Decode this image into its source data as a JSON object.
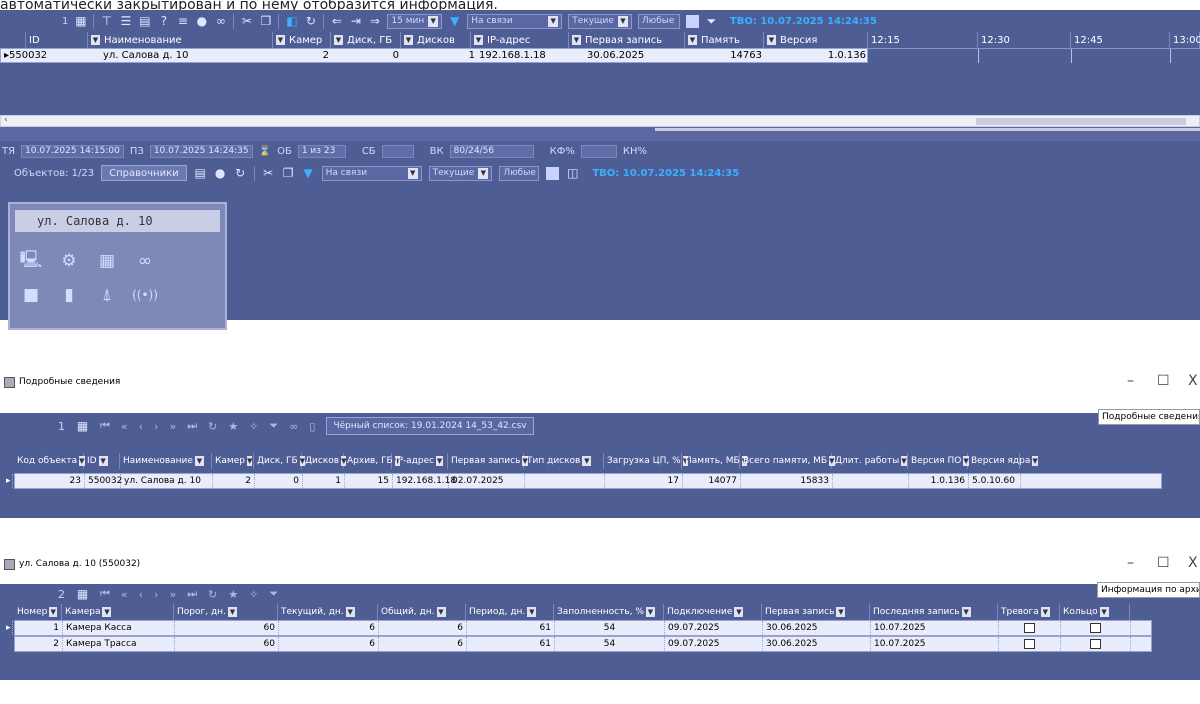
{
  "caption": "автоматически закрытирован и по нему отобразится информация.",
  "panel1": {
    "toolbar": {
      "num": "1",
      "interval": "15 мин",
      "status": "На связи",
      "mode": "Текущие",
      "any": "Любые",
      "tvo": "ТВО: 10.07.2025 14:24:35"
    },
    "columns": [
      "ID",
      "Наименование",
      "Камер",
      "Диск, ГБ",
      "Дисков",
      "IP-адрес",
      "Первая запись",
      "Память",
      "Версия"
    ],
    "row": {
      "id": "550032",
      "name": "ул. Салова д. 10",
      "cams": "2",
      "disk": "0",
      "disks": "1",
      "ip": "192.168.1.18",
      "first": "30.06.2025",
      "mem": "14763",
      "ver": "1.0.136"
    },
    "timeline": [
      "12:15",
      "12:30",
      "12:45",
      "13:00"
    ],
    "status": {
      "ta_label": "ТЯ",
      "ta": "10.07.2025 14:15:00",
      "pz_label": "ПЗ",
      "pz": "10.07.2025 14:24:35",
      "ob_label": "ОБ",
      "ob": "1 из 23",
      "sb_label": "СБ",
      "sb": "",
      "vk_label": "ВК",
      "vk": "80/24/56",
      "kf_label": "КФ%",
      "kf": "",
      "kn_label": "КН%"
    },
    "toolbar2": {
      "objects": "Объектов: 1/23",
      "sprav": "Справочники",
      "status": "На связи",
      "mode": "Текущие",
      "any": "Любые",
      "tvo": "ТВО: 10.07.2025 14:24:35"
    },
    "card_title": "ул. Салова д. 10"
  },
  "panel2": {
    "title": "Подробные сведения",
    "num": "1",
    "csv": "Чёрный список: 19.01.2024 14_53_42.csv",
    "tag": "Подробные сведения",
    "columns": [
      "Код объекта",
      "ID",
      "Наименование",
      "Камер",
      "Диск, ГБ",
      "Дисков",
      "Архив, ГБ",
      "IP-адрес",
      "Первая запись",
      "Тип дисков",
      "Загрузка ЦП, %",
      "Память, МБ",
      "Всего памяти, МБ",
      "Длит. работы",
      "Версия ПО",
      "Версия ядра"
    ],
    "row": [
      "23",
      "550032",
      "ул. Салова д. 10",
      "2",
      "0",
      "1",
      "15",
      "192.168.1.18",
      "02.07.2025",
      "",
      "17",
      "14077",
      "15833",
      "",
      "1.0.136",
      "5.0.10.60"
    ]
  },
  "panel3": {
    "title": "ул. Салова д. 10 (550032)",
    "num": "2",
    "tag": "Информация по архивам",
    "columns": [
      "Номер",
      "Камера",
      "Порог, дн.",
      "Текущий, дн.",
      "Общий, дн.",
      "Период, дн.",
      "Заполненность, %",
      "Подключение",
      "Первая запись",
      "Последняя запись",
      "Тревога",
      "Кольцо"
    ],
    "rows": [
      [
        "1",
        "Камера Касса",
        "60",
        "6",
        "6",
        "61",
        "54",
        "09.07.2025",
        "30.06.2025",
        "10.07.2025"
      ],
      [
        "2",
        "Камера Трасса",
        "60",
        "6",
        "6",
        "61",
        "54",
        "09.07.2025",
        "30.06.2025",
        "10.07.2025"
      ]
    ]
  },
  "window_controls": {
    "min": "–",
    "max": "☐",
    "close": "X"
  }
}
